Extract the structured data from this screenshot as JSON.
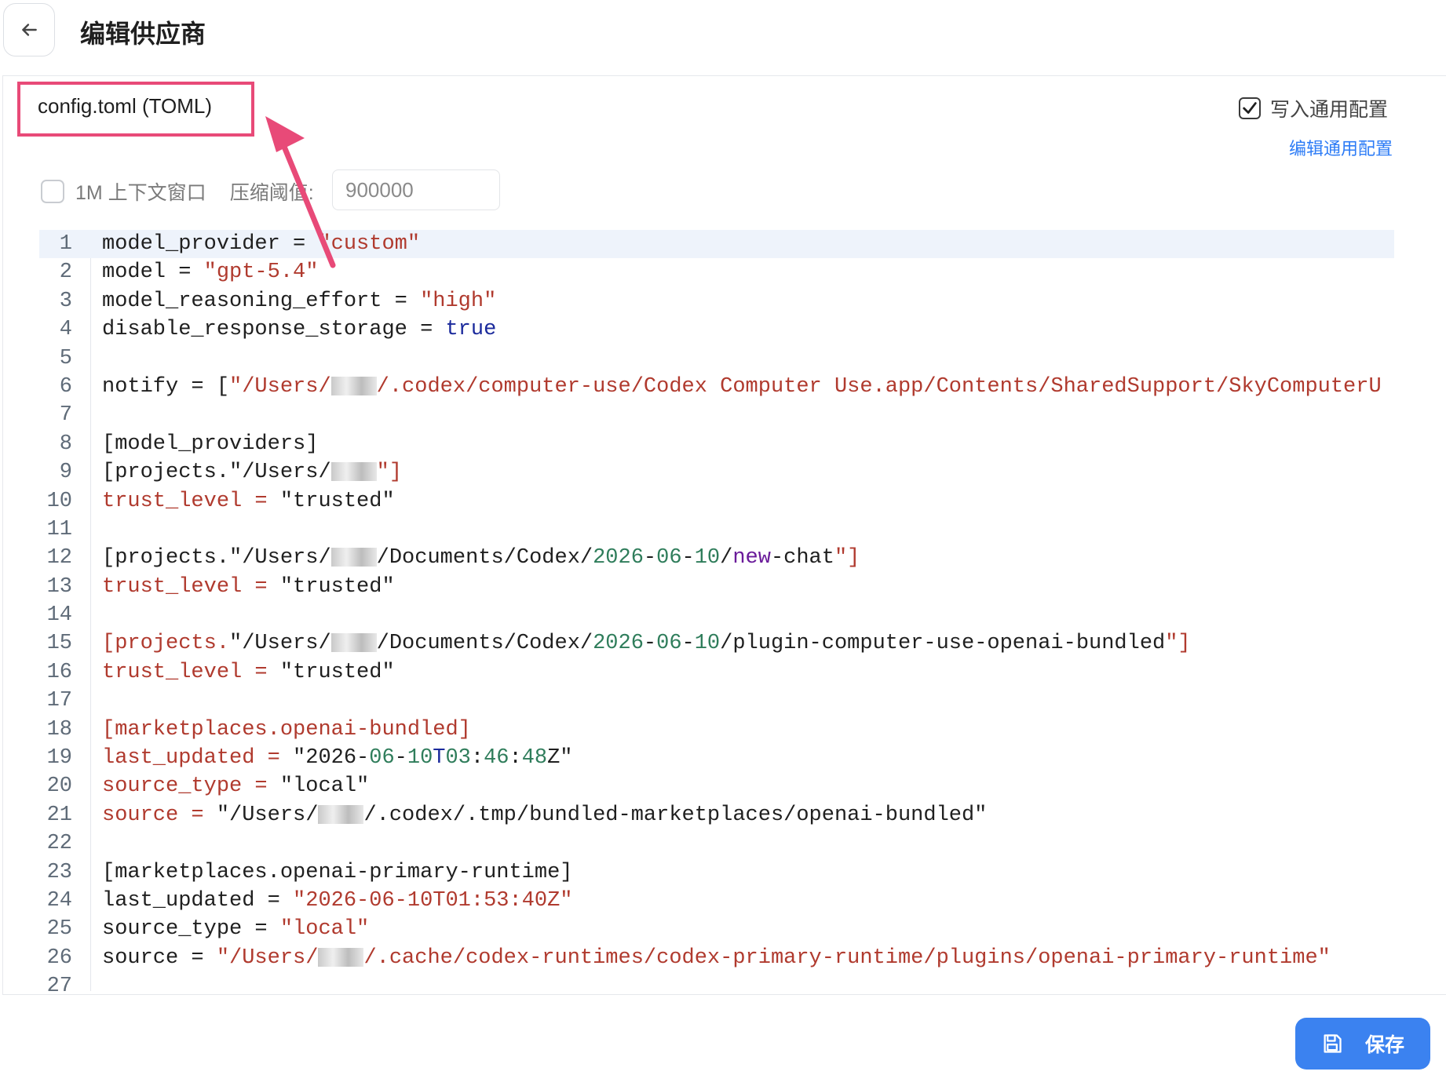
{
  "header": {
    "title": "编辑供应商"
  },
  "config": {
    "file_label": "config.toml (TOML)",
    "write_common_label": "写入通用配置",
    "write_common_checked": true,
    "edit_common_link": "编辑通用配置",
    "context_window_label": "1M 上下文窗口",
    "context_window_checked": false,
    "threshold_label": "压缩阈值:",
    "threshold_value": "900000"
  },
  "editor": {
    "line_numbers": [
      "1",
      "2",
      "3",
      "4",
      "5",
      "6",
      "7",
      "8",
      "9",
      "10",
      "11",
      "12",
      "13",
      "14",
      "15",
      "16",
      "17",
      "18",
      "19",
      "20",
      "21",
      "22",
      "23",
      "24",
      "25",
      "26",
      "27"
    ],
    "line_text": {
      "l1a": "model_provider = ",
      "l1b": "\"custom\"",
      "l2a": "model = ",
      "l2b": "\"gpt-5.4\"",
      "l3a": "model_reasoning_effort = ",
      "l3b": "\"high\"",
      "l4a": "disable_response_storage = ",
      "l4b": "true",
      "l6a": "notify = [",
      "l6b": "\"/Users/",
      "l6c": "/.codex/computer-use/Codex Computer Use.app/Contents/SharedSupport/SkyComputerU",
      "l8": "[model_providers]",
      "l9a": "[projects.\"/Users/",
      "l9b": "\"]",
      "l10a": "trust_level = ",
      "l10b": "\"trusted\"",
      "l12a": "[projects.\"/Users/",
      "l12b": "/Documents/Codex/",
      "l12c": "2026",
      "l12d": "-",
      "l12e": "06",
      "l12f": "-",
      "l12g": "10",
      "l12h": "/",
      "l12i": "new",
      "l12j": "-chat",
      "l12k": "\"]",
      "l13a": "trust_level = ",
      "l13b": "\"trusted\"",
      "l15a": "[projects.",
      "l15b": "\"/Users/",
      "l15c": "/Documents/Codex/",
      "l15d": "2026",
      "l15e": "-",
      "l15f": "06",
      "l15g": "-",
      "l15h": "10",
      "l15i": "/plugin-computer-use-openai-bundled",
      "l15j": "\"]",
      "l16a": "trust_level = ",
      "l16b": "\"trusted\"",
      "l18": "[marketplaces.openai-bundled]",
      "l19a": "last_updated = ",
      "l19b": "\"2026-",
      "l19c": "06",
      "l19d": "-",
      "l19e": "10",
      "l19f": "T",
      "l19g": "03",
      "l19h": ":",
      "l19i": "46",
      "l19j": ":",
      "l19k": "48",
      "l19l": "Z\"",
      "l20a": "source_type = ",
      "l20b": "\"local\"",
      "l21a": "source = ",
      "l21b": "\"/Users/",
      "l21c": "/.codex/.tmp/bundled-marketplaces/openai-bundled\"",
      "l23": "[marketplaces.openai-primary-runtime]",
      "l24a": "last_updated = ",
      "l24b": "\"2026-06-10T01:53:40Z\"",
      "l25a": "source_type = ",
      "l25b": "\"local\"",
      "l26a": "source = ",
      "l26b": "\"/Users/",
      "l26c": "/.cache/codex-runtimes/codex-primary-runtime/plugins/openai-primary-runtime\""
    }
  },
  "footer": {
    "save_label": "保存"
  },
  "colors": {
    "accent": "#3b82f0",
    "highlight_border": "#e84a78",
    "string": "#b03a2e",
    "keyword": "#1b2a9c"
  },
  "icons": {
    "back": "arrow-left-icon",
    "save": "save-icon",
    "check": "check-icon"
  }
}
